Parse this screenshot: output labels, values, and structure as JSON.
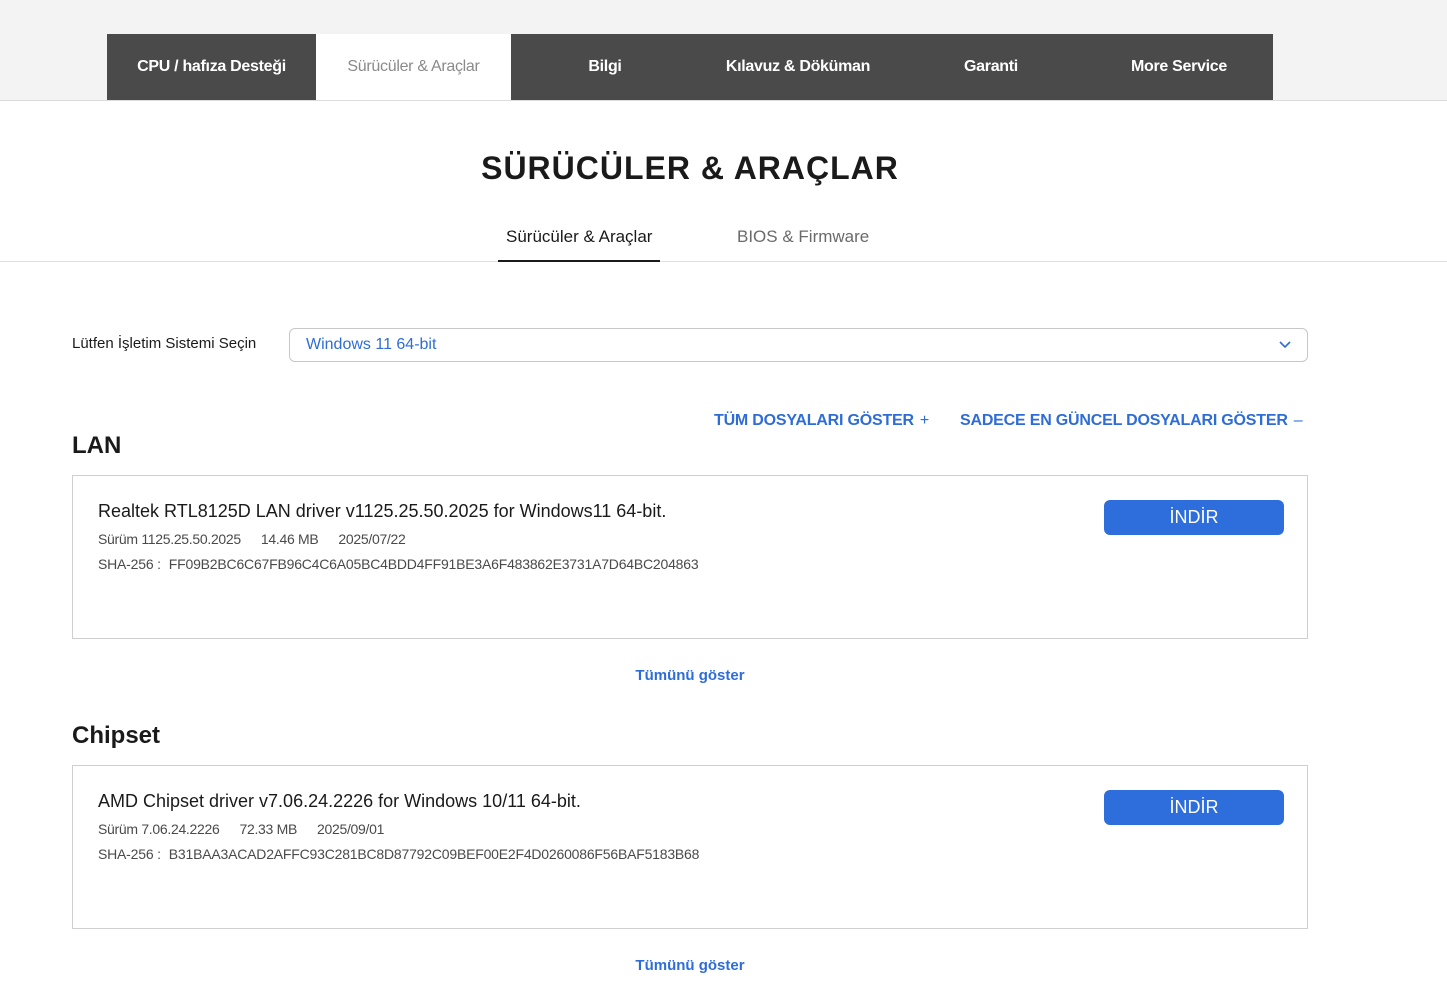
{
  "nav": {
    "tabs": [
      {
        "label": "CPU / hafıza Desteği"
      },
      {
        "label": "Sürücüler & Araçlar"
      },
      {
        "label": "Bilgi"
      },
      {
        "label": "Kılavuz & Döküman"
      },
      {
        "label": "Garanti"
      },
      {
        "label": "More Service"
      }
    ],
    "active_tab": "Sürücüler & Araçlar"
  },
  "page": {
    "title": "SÜRÜCÜLER & ARAÇLAR",
    "subtabs": [
      {
        "label": "Sürücüler & Araçlar"
      },
      {
        "label": "BIOS & Firmware"
      }
    ]
  },
  "os_select": {
    "label": "Lütfen İşletim Sistemi Seçin",
    "value": "Windows 11 64-bit"
  },
  "file_filters": {
    "show_all": "TÜM DOSYALARI GÖSTER",
    "show_all_symbol": "+",
    "show_latest": "SADECE EN GÜNCEL DOSYALARI GÖSTER",
    "show_latest_symbol": "–"
  },
  "sections": [
    {
      "title": "LAN",
      "driver": {
        "name": "Realtek RTL8125D LAN driver v1125.25.50.2025 for Windows11 64-bit.",
        "version": "Sürüm 1125.25.50.2025",
        "size": "14.46 MB",
        "date": "2025/07/22",
        "sha_label": "SHA-256 :",
        "sha": "FF09B2BC6C67FB96C4C6A05BC4BDD4FF91BE3A6F483862E3731A7D64BC204863",
        "download_label": "İNDİR"
      },
      "more_label": "Tümünü göster"
    },
    {
      "title": "Chipset",
      "driver": {
        "name": "AMD Chipset driver v7.06.24.2226 for Windows 10/11 64-bit.",
        "version": "Sürüm 7.06.24.2226",
        "size": "72.33 MB",
        "date": "2025/09/01",
        "sha_label": "SHA-256 :",
        "sha": "B31BAA3ACAD2AFFC93C281BC8D87792C09BEF00E2F4D0260086F56BAF5183B68",
        "download_label": "İNDİR"
      },
      "more_label": "Tümünü göster"
    }
  ],
  "colors": {
    "accent": "#2f6dd6",
    "button": "#2d6ddc",
    "tabbar": "#4a4a4a"
  },
  "icons": {
    "select_chevron": "chevron-down-icon"
  }
}
